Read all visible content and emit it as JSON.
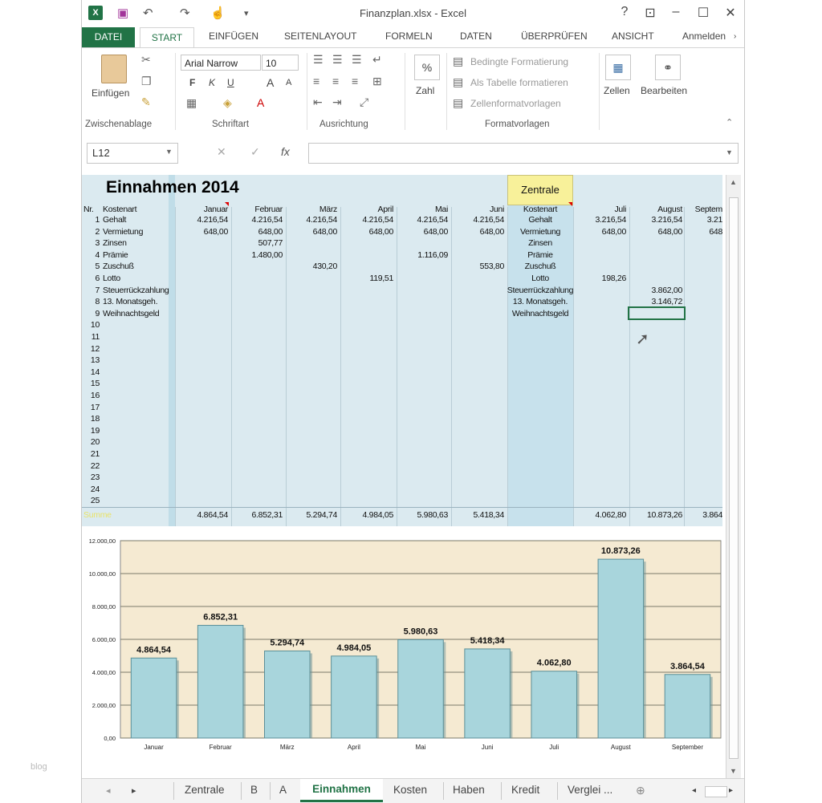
{
  "window": {
    "title": "Finanzplan.xlsx - Excel"
  },
  "quick_access": {
    "excel_icon": "excel-icon",
    "save_icon": "save-icon",
    "undo_icon": "undo-icon",
    "redo_icon": "redo-icon",
    "touch_icon": "touch-mode-icon"
  },
  "window_buttons": {
    "help": "?",
    "ribbon_options": "⊡",
    "minimize": "–",
    "maximize": "☐",
    "close": "✕"
  },
  "ribbon_tabs": [
    "DATEI",
    "START",
    "EINFÜGEN",
    "SEITENLAYOUT",
    "FORMELN",
    "DATEN",
    "ÜBERPRÜFEN",
    "ANSICHT"
  ],
  "account_label": "Anmelden",
  "ribbon": {
    "clipboard": {
      "paste": "Einfügen",
      "group": "Zwischenablage"
    },
    "font": {
      "name": "Arial Narrow",
      "size": "10",
      "bold": "F",
      "italic": "K",
      "underline": "U",
      "grow": "A",
      "shrink": "A",
      "group": "Schriftart"
    },
    "alignment": {
      "group": "Ausrichtung"
    },
    "number": {
      "label": "Zahl",
      "symbol": "%"
    },
    "styles": {
      "conditional": "Bedingte Formatierung",
      "table": "Als Tabelle formatieren",
      "cellstyles": "Zellenformatvorlagen",
      "group": "Formatvorlagen"
    },
    "cells": {
      "label": "Zellen"
    },
    "editing": {
      "label": "Bearbeiten"
    }
  },
  "formula_bar": {
    "name_box": "L12",
    "cancel": "✕",
    "enter": "✓",
    "fx": "fx",
    "value": ""
  },
  "sheet": {
    "title": "Einnahmen 2014",
    "zentrale_button": "Zentrale",
    "header_nr": "Nr.",
    "header_kostenart": "Kostenart",
    "months_left": [
      "Januar",
      "Februar",
      "März",
      "April",
      "Mai",
      "Juni"
    ],
    "months_right": [
      "Juli",
      "August",
      "Septem"
    ],
    "rows": [
      {
        "nr": "1",
        "name": "Gehalt",
        "m": [
          "4.216,54",
          "4.216,54",
          "4.216,54",
          "4.216,54",
          "4.216,54",
          "4.216,54"
        ],
        "r": [
          "3.216,54",
          "3.216,54",
          "3.21"
        ]
      },
      {
        "nr": "2",
        "name": "Vermietung",
        "m": [
          "648,00",
          "648,00",
          "648,00",
          "648,00",
          "648,00",
          "648,00"
        ],
        "r": [
          "648,00",
          "648,00",
          "648"
        ]
      },
      {
        "nr": "3",
        "name": "Zinsen",
        "m": [
          "",
          "507,77",
          "",
          "",
          "",
          ""
        ],
        "r": [
          "",
          "",
          ""
        ]
      },
      {
        "nr": "4",
        "name": "Prämie",
        "m": [
          "",
          "1.480,00",
          "",
          "",
          "1.116,09",
          ""
        ],
        "r": [
          "",
          "",
          ""
        ]
      },
      {
        "nr": "5",
        "name": "Zuschuß",
        "m": [
          "",
          "",
          "430,20",
          "",
          "",
          "553,80"
        ],
        "r": [
          "",
          "",
          ""
        ]
      },
      {
        "nr": "6",
        "name": "Lotto",
        "m": [
          "",
          "",
          "",
          "119,51",
          "",
          ""
        ],
        "r": [
          "198,26",
          "",
          ""
        ]
      },
      {
        "nr": "7",
        "name": "Steuerrückzahlung",
        "m": [
          "",
          "",
          "",
          "",
          "",
          ""
        ],
        "r": [
          "",
          "3.862,00",
          ""
        ]
      },
      {
        "nr": "8",
        "name": "13. Monatsgeh.",
        "m": [
          "",
          "",
          "",
          "",
          "",
          ""
        ],
        "r": [
          "",
          "3.146,72",
          ""
        ]
      },
      {
        "nr": "9",
        "name": "Weihnachtsgeld",
        "m": [
          "",
          "",
          "",
          "",
          "",
          ""
        ],
        "r": [
          "",
          "",
          ""
        ]
      }
    ],
    "empty_row_numbers": [
      "10",
      "11",
      "12",
      "13",
      "14",
      "15",
      "16",
      "17",
      "18",
      "19",
      "20",
      "21",
      "22",
      "23",
      "24",
      "25"
    ],
    "total_label": "Summe",
    "totals_left": [
      "4.864,54",
      "6.852,31",
      "5.294,74",
      "4.984,05",
      "5.980,63",
      "5.418,34"
    ],
    "totals_right": [
      "4.062,80",
      "10.873,26",
      "3.864"
    ]
  },
  "chart_data": {
    "type": "bar",
    "categories": [
      "Januar",
      "Februar",
      "März",
      "April",
      "Mai",
      "Juni",
      "Juli",
      "August",
      "September"
    ],
    "values": [
      4864.54,
      6852.31,
      5294.74,
      4984.05,
      5980.63,
      5418.34,
      4062.8,
      10873.26,
      3864.54
    ],
    "value_labels": [
      "4.864,54",
      "6.852,31",
      "5.294,74",
      "4.984,05",
      "5.980,63",
      "5.418,34",
      "4.062,80",
      "10.873,26",
      "3.864,54"
    ],
    "yticks": [
      "0,00",
      "2.000,00",
      "4.000,00",
      "6.000,00",
      "8.000,00",
      "10.000,00",
      "12.000,00"
    ],
    "ylim": [
      0,
      12000
    ],
    "grid": true,
    "bar_color": "#a8d5dc",
    "plot_background": "#f5ead2"
  },
  "sheet_tabs": [
    "Zentrale",
    "B",
    "A",
    "Einnahmen",
    "Kosten",
    "Haben",
    "Kredit",
    "Verglei ..."
  ],
  "active_sheet": "Einnahmen",
  "watermark": "blog",
  "colors": {
    "excel_green": "#217346",
    "sheet_blue": "#dbeaf0",
    "zentrale_yellow": "#f8f19a",
    "total_label": "#e9e36a"
  }
}
